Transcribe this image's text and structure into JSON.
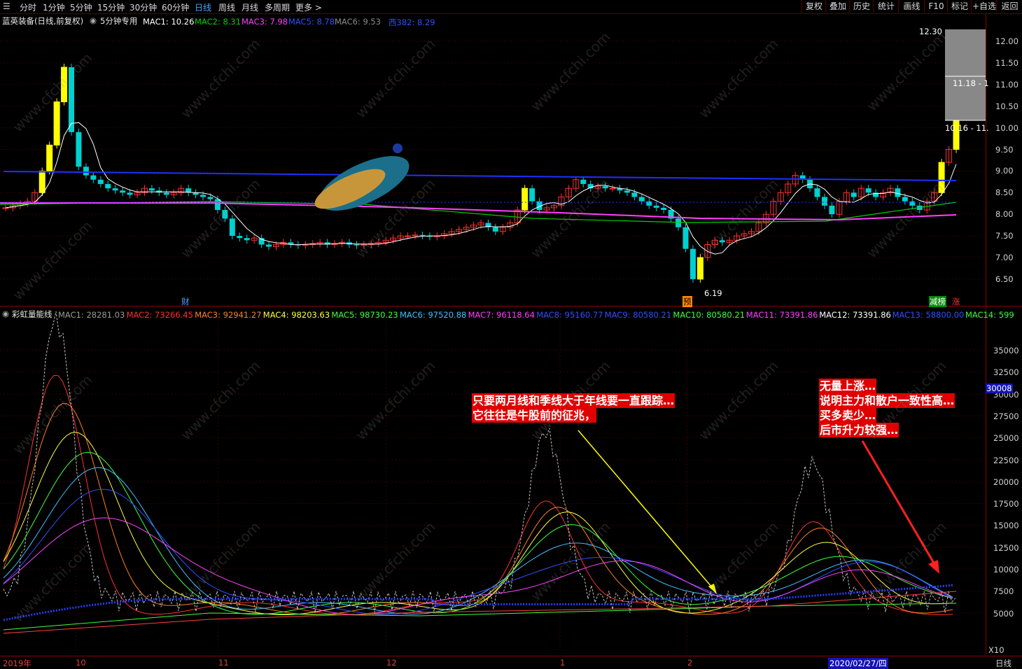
{
  "periods": [
    "分时",
    "1分钟",
    "5分钟",
    "15分钟",
    "30分钟",
    "60分钟",
    "日线",
    "周线",
    "月线",
    "多周期",
    "更多 >"
  ],
  "active_period": "日线",
  "right_buttons": [
    "复权",
    "叠加",
    "历史",
    "统计",
    "画线",
    "F10",
    "标记",
    "+自选",
    "返回"
  ],
  "title": "蓝英装备(日线,前复权)",
  "indicator_label": "5分钟专用",
  "ma": [
    {
      "name": "MAC1",
      "value": "10.26",
      "color": "#ffffff"
    },
    {
      "name": "MAC2",
      "value": "8.31",
      "color": "#00d000"
    },
    {
      "name": "MAC3",
      "value": "7.98",
      "color": "#ff40ff"
    },
    {
      "name": "MAC5",
      "value": "8.78",
      "color": "#3050ff"
    },
    {
      "name": "MAC6",
      "value": "9.53",
      "color": "#8a8a8a"
    },
    {
      "name": "西382",
      "value": "8.29",
      "color": "#3050ff"
    }
  ],
  "price_ticks": [
    "12.00",
    "11.50",
    "11.00",
    "10.50",
    "10.00",
    "9.50",
    "9.00",
    "8.50",
    "8.00",
    "7.50",
    "7.00",
    "6.50"
  ],
  "price_labels": {
    "high": "12.30",
    "mid": "11.18 - 1",
    "low": "10.16 - 11.",
    "min": "6.19"
  },
  "markers": {
    "cai": "财",
    "yu": "预",
    "longhu": "减榜",
    "zhang": "涨"
  },
  "vol_title": "彩虹量能线",
  "vol_ma": [
    {
      "name": "MAC1",
      "value": "28281.03",
      "color": "#9a9a9a"
    },
    {
      "name": "MAC2",
      "value": "73266.45",
      "color": "#ff3030"
    },
    {
      "name": "MAC3",
      "value": "92941.27",
      "color": "#ff8020"
    },
    {
      "name": "MAC4",
      "value": "98203.63",
      "color": "#ffff40"
    },
    {
      "name": "MAC5",
      "value": "98730.23",
      "color": "#40ff40"
    },
    {
      "name": "MAC6",
      "value": "97520.88",
      "color": "#40c0ff"
    },
    {
      "name": "MAC7",
      "value": "96118.64",
      "color": "#ff40ff"
    },
    {
      "name": "MAC8",
      "value": "95160.77",
      "color": "#3050ff"
    },
    {
      "name": "MAC9",
      "value": "80580.21",
      "color": "#3050ff"
    },
    {
      "name": "MAC10",
      "value": "80580.21",
      "color": "#40ff40"
    },
    {
      "name": "MAC11",
      "value": "73391.86",
      "color": "#ff40ff"
    },
    {
      "name": "MAC12",
      "value": "73391.86",
      "color": "#ffffff"
    },
    {
      "name": "MAC13",
      "value": "58800.00",
      "color": "#3050ff"
    },
    {
      "name": "MAC14",
      "value": "599",
      "color": "#40ff40"
    }
  ],
  "vol_ticks": [
    "35000",
    "32500",
    "30000",
    "27500",
    "25000",
    "22500",
    "20000",
    "17500",
    "15000",
    "12500",
    "10000",
    "7500",
    "5000"
  ],
  "vol_current": "30008",
  "vol_multiplier": "X10",
  "annotation_left": [
    "只要两月线和季线大于年线要一直跟踪…",
    "它往往是牛股前的征兆，"
  ],
  "annotation_right": [
    "无量上涨…",
    "说明主力和散户一致性高…",
    "买多卖少…",
    "后市升力较强…"
  ],
  "dates": [
    "2019年",
    "10",
    "11",
    "12",
    "1",
    "2",
    "2020/02/27/四"
  ],
  "period_bottom": "日线",
  "watermark": "www.cfchi.com",
  "colors": {
    "up": "#ff3030",
    "down": "#00d0d0",
    "grid": "#8b0000"
  }
}
